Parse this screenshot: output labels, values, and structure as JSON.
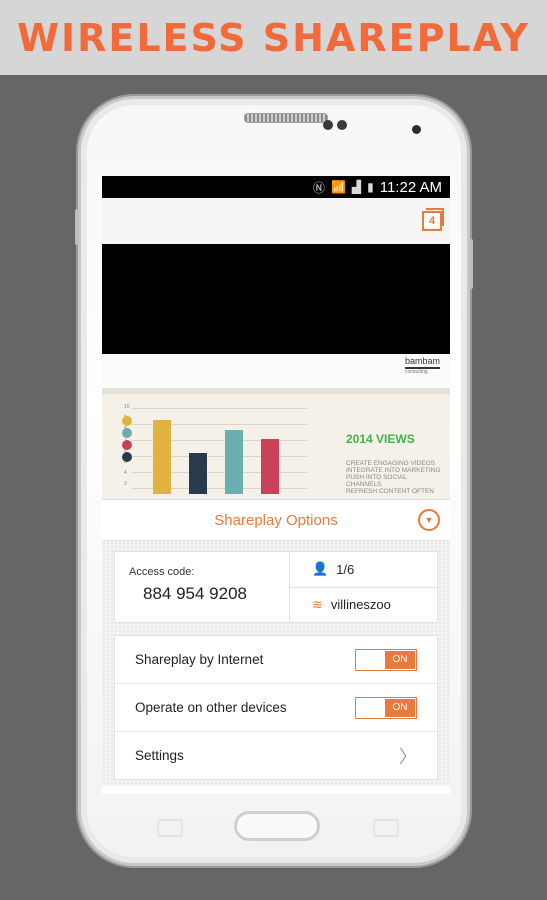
{
  "banner": {
    "title": "WIRELESS SHAREPLAY"
  },
  "status_bar": {
    "time": "11:22 AM",
    "icons": [
      "nfc-icon",
      "wifi-icon",
      "signal-icon",
      "battery-icon"
    ]
  },
  "app_bar": {
    "tab_count": "4"
  },
  "slide": {
    "brand_name": "bambam",
    "brand_sub": "consulting",
    "views_title": "2014 VIEWS",
    "views_lines": [
      "Create engaging videos",
      "Integrate into marketing",
      "Push into social",
      "channels",
      "Refresh content often"
    ],
    "y_ticks": [
      "10",
      "9",
      "8",
      "7",
      "6",
      "5",
      "4",
      "3"
    ],
    "bar_values": [
      8,
      4.5,
      7,
      6
    ],
    "bar_colors": [
      "#e0b240",
      "#2a3a4d",
      "#6aaeb0",
      "#c9425a"
    ],
    "legend_dot_colors": [
      "#e0b240",
      "#6aaeb0",
      "#c9425a",
      "#2a3a4d"
    ]
  },
  "options": {
    "title": "Shareplay Options"
  },
  "access": {
    "label": "Access code:",
    "code": "884 954 9208",
    "users": "1/6",
    "network": "villineszoo"
  },
  "settings": [
    {
      "label": "Shareplay by Internet",
      "state": "ON"
    },
    {
      "label": "Operate on other devices",
      "state": "ON"
    },
    {
      "label": "Settings"
    }
  ],
  "colors": {
    "accent": "#e87a3f",
    "banner_text": "#f26a3a",
    "banner_bg": "#d6d6d6",
    "background": "#666666"
  }
}
